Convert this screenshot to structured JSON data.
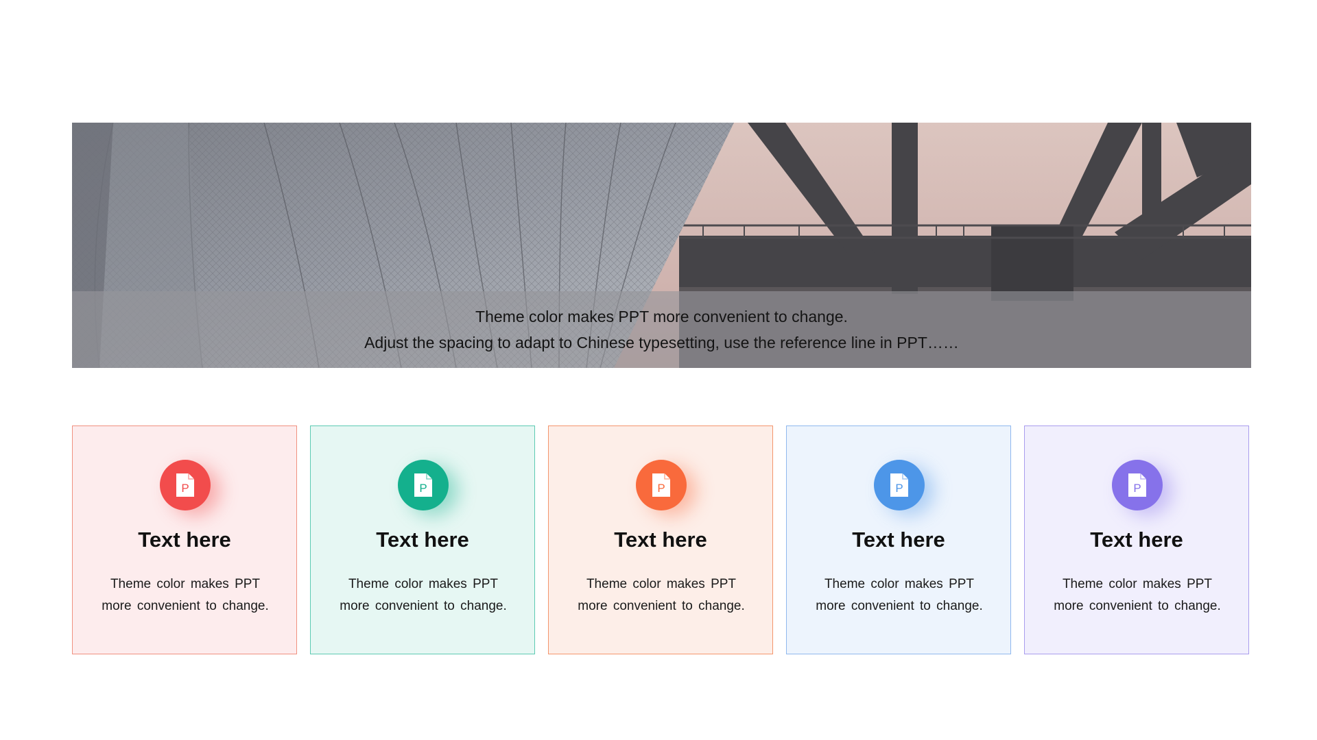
{
  "banner": {
    "line1": "Theme color makes PPT more convenient to change.",
    "line2": "Adjust the spacing to adapt to Chinese typesetting, use the reference line in PPT……"
  },
  "cards": [
    {
      "title": "Text here",
      "description": "Theme color makes PPT more convenient to change.",
      "icon": "document-p-icon",
      "icon_letter": "P",
      "color": "#f24c4c"
    },
    {
      "title": "Text here",
      "description": "Theme color makes PPT more convenient to change.",
      "icon": "document-p-icon",
      "icon_letter": "P",
      "color": "#14b08d"
    },
    {
      "title": "Text here",
      "description": "Theme color makes PPT more convenient to change.",
      "icon": "document-p-icon",
      "icon_letter": "P",
      "color": "#f96a3c"
    },
    {
      "title": "Text here",
      "description": "Theme color makes PPT more convenient to change.",
      "icon": "document-p-icon",
      "icon_letter": "P",
      "color": "#4d96e8"
    },
    {
      "title": "Text here",
      "description": "Theme color makes PPT more convenient to change.",
      "icon": "document-p-icon",
      "icon_letter": "P",
      "color": "#8672ea"
    }
  ]
}
